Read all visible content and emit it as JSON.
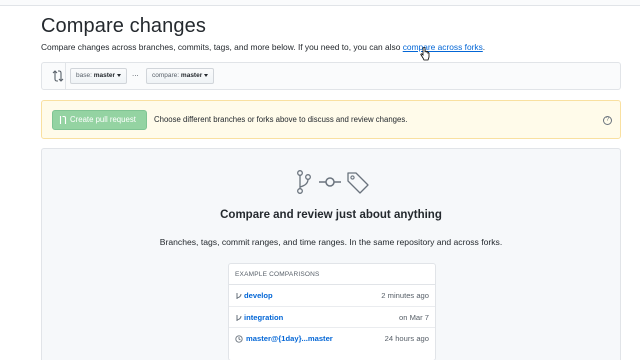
{
  "page": {
    "title": "Compare changes",
    "subtitle_text": "Compare changes across branches, commits, tags, and more below. If you need to, you can also",
    "subtitle_link": "compare across forks",
    "subtitle_end": "."
  },
  "range": {
    "base_prefix": "base:",
    "base_value": "master",
    "separator": "...",
    "compare_prefix": "compare:",
    "compare_value": "master"
  },
  "flash": {
    "button_label": "Create pull request",
    "message": "Choose different branches or forks above to discuss and review changes.",
    "help_glyph": "?"
  },
  "blankslate": {
    "icons": [
      "git-branch-icon",
      "git-commit-icon",
      "tag-icon"
    ],
    "title": "Compare and review just about anything",
    "description": "Branches, tags, commit ranges, and time ranges. In the same repository and across forks."
  },
  "examples": {
    "header": "EXAMPLE COMPARISONS",
    "rows": [
      {
        "icon": "git-branch-icon",
        "label": "develop",
        "time": "2 minutes ago"
      },
      {
        "icon": "git-branch-icon",
        "label": "integration",
        "time": "on Mar 7"
      },
      {
        "icon": "clock-icon",
        "label": "master@{1day}...master",
        "time": "24 hours ago"
      }
    ]
  },
  "colors": {
    "link": "#0366d6",
    "flash_bg": "#fffbea",
    "pr_button": "#94d3a2"
  }
}
